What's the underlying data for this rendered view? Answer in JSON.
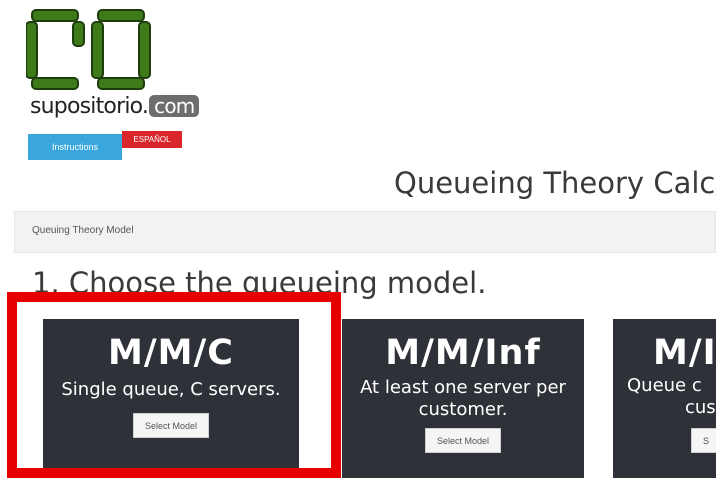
{
  "logo": {
    "icon": "two-digit-green-logo",
    "text_main": "supositorio.",
    "text_badge": "com",
    "color": "#3f7a1a"
  },
  "header": {
    "instructions_label": "Instructions",
    "language_label": "ESPAÑOL"
  },
  "page": {
    "title": "Queueing Theory Calc"
  },
  "breadcrumb": {
    "label": "Queuing Theory Model"
  },
  "step": {
    "heading": "1. Choose the queueing model."
  },
  "colors": {
    "card_bg": "#2e3138",
    "highlight": "#e60000",
    "instructions_bg": "#3aa6de",
    "language_bg": "#d9262b"
  },
  "models": [
    {
      "title": "M/M/C",
      "description": "Single queue, C servers.",
      "button": "Select Model"
    },
    {
      "title": "M/M/Inf",
      "description": "At least one server per customer.",
      "button": "Select Model"
    },
    {
      "title": "M/I",
      "description": "Queue c",
      "description_line2": "cus",
      "button": "S"
    }
  ]
}
